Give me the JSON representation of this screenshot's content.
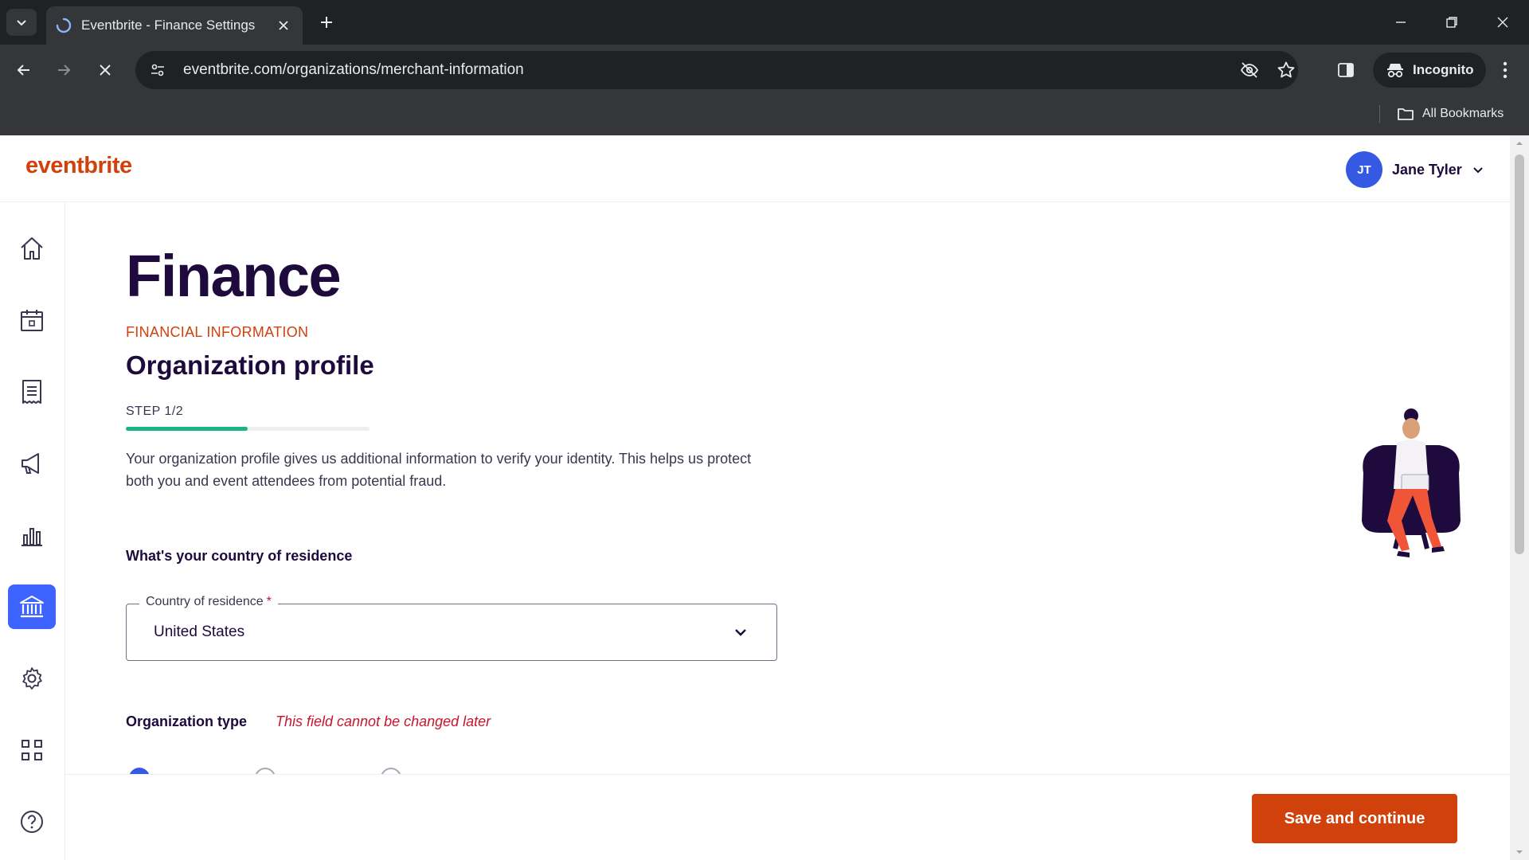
{
  "browser": {
    "tab_title": "Eventbrite - Finance Settings",
    "url": "eventbrite.com/organizations/merchant-information",
    "incognito_label": "Incognito",
    "bookmarks_label": "All Bookmarks"
  },
  "header": {
    "logo": "eventbrite",
    "user_initials": "JT",
    "user_name": "Jane Tyler"
  },
  "sidebar": {
    "items": [
      {
        "name": "home",
        "icon": "home-icon",
        "active": false
      },
      {
        "name": "events",
        "icon": "calendar-icon",
        "active": false
      },
      {
        "name": "orders",
        "icon": "receipt-icon",
        "active": false
      },
      {
        "name": "marketing",
        "icon": "megaphone-icon",
        "active": false
      },
      {
        "name": "reporting",
        "icon": "bar-chart-icon",
        "active": false
      },
      {
        "name": "finance",
        "icon": "bank-icon",
        "active": true
      },
      {
        "name": "settings",
        "icon": "gear-icon",
        "active": false
      },
      {
        "name": "apps",
        "icon": "grid-icon",
        "active": false
      },
      {
        "name": "help",
        "icon": "help-icon",
        "active": false
      }
    ]
  },
  "main": {
    "title": "Finance",
    "eyebrow": "FINANCIAL INFORMATION",
    "section_title": "Organization profile",
    "step_label": "STEP 1/2",
    "progress": 0.5,
    "description": "Your organization profile gives us additional information to verify your identity. This helps us protect both you and event attendees from potential fraud.",
    "country_question": "What's your country of residence",
    "country_field": {
      "label": "Country of residence",
      "required_mark": "*",
      "value": "United States"
    },
    "org_type_label": "Organization type",
    "org_type_warning": "This field cannot be changed later"
  },
  "footer": {
    "save_label": "Save and continue"
  },
  "colors": {
    "brand": "#d1410c",
    "active_nav": "#3d64ff",
    "progress": "#1ab385",
    "avatar": "#3659e3",
    "warning": "#c5162e"
  }
}
